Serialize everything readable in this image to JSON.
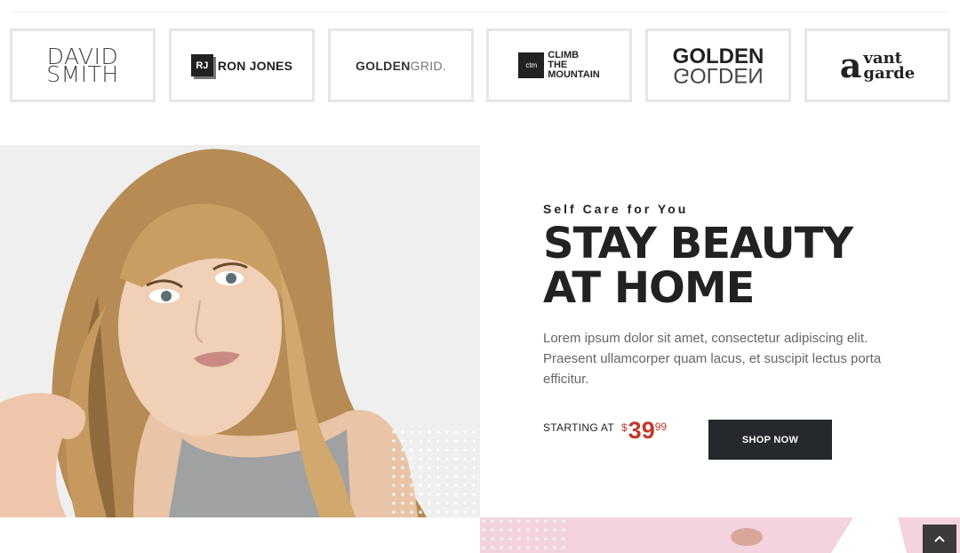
{
  "brands": [
    {
      "name_line1": "DAVID",
      "name_line2": "SMITH"
    },
    {
      "badge": "RJ",
      "name": "RON JONES"
    },
    {
      "bold": "GOLDEN",
      "light": "GRID."
    },
    {
      "badge": "ctm",
      "line1": "CLIMB",
      "line2": "THE",
      "line3": "MOUNTAIN"
    },
    {
      "top": "GOLDEN",
      "mirror": "GOLDEN"
    },
    {
      "initial": "a",
      "line1": "vant",
      "line2": "garde"
    }
  ],
  "promo": {
    "eyebrow": "Self Care for You",
    "headline_line1": "STAY BEAUTY",
    "headline_line2": "AT HOME",
    "description": "Lorem ipsum dolor sit amet, consectetur adipiscing elit. Praesent ullamcorper quam lacus, et suscipit lectus porta efficitur.",
    "starting_label": "STARTING AT",
    "currency": "$",
    "price_whole": "39",
    "price_cents": "99",
    "button_label": "SHOP NOW"
  },
  "colors": {
    "accent_price": "#c0392b",
    "button_bg": "#25282d",
    "pink_banner": "#f3d3de"
  },
  "icons": {
    "scroll_top": "chevron-up-icon",
    "hero_image": "woman-portrait-photo"
  }
}
